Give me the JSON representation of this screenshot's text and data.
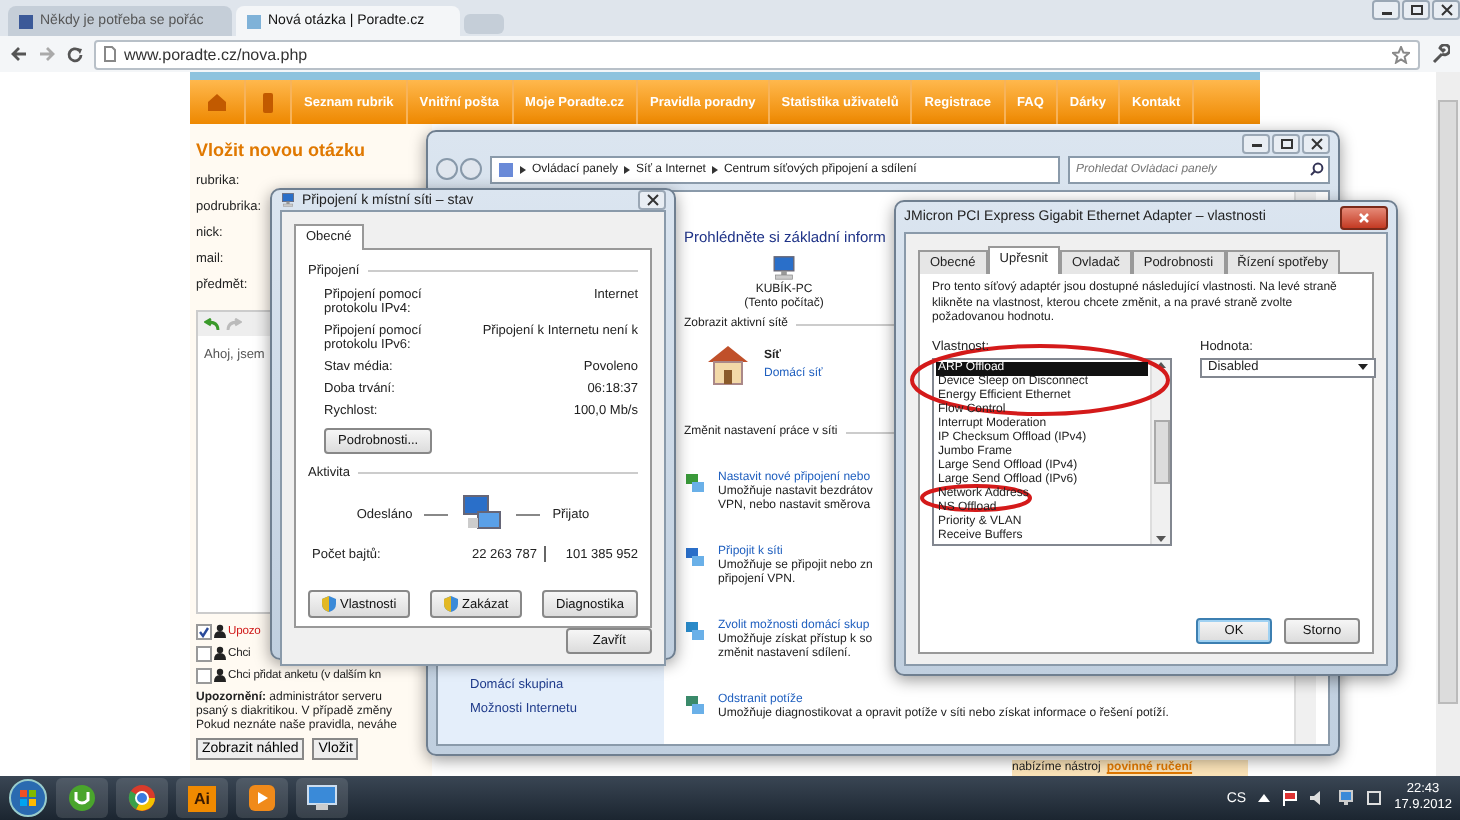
{
  "browser": {
    "tabs": [
      {
        "title": "Někdy je potřeba se pořác",
        "selected": false
      },
      {
        "title": "Nová otázka | Poradte.cz",
        "selected": true
      }
    ],
    "url": "www.poradte.cz/nova.php"
  },
  "site": {
    "nav": [
      "Seznam rubrik",
      "Vnitřní pošta",
      "Moje Poradte.cz",
      "Pravidla poradny",
      "Statistika uživatelů",
      "Registrace",
      "FAQ",
      "Dárky",
      "Kontakt"
    ],
    "form": {
      "title": "Vložit novou otázku",
      "fields": [
        "rubrika:",
        "podrubrika:",
        "nick:",
        "mail:",
        "předmět:"
      ],
      "editor_text": "Ahoj, jsem",
      "options": [
        {
          "label": "Upozo",
          "checked": true,
          "kind": "warning"
        },
        {
          "label": "Chci",
          "checked": false,
          "kind": "normal"
        },
        {
          "label": "Chci přidat anketu (v dalším kn",
          "checked": false,
          "kind": "normal"
        }
      ],
      "notice_lines": [
        "**Upozornění:** administrátor serveru",
        "psaný s diakritikou. V případě změny",
        "Pokud neznáte naše pravidla, neváhe"
      ],
      "buttons": [
        "Zobrazit náhled",
        "Vložit"
      ]
    },
    "ad": {
      "text": "nabízíme nástroj",
      "link": "povinné ručení"
    }
  },
  "control_panel": {
    "breadcrumb": [
      "Ovládací panely",
      "Síť a Internet",
      "Centrum síťových připojení a sdílení"
    ],
    "search_placeholder": "Prohledat Ovládací panely",
    "sidebar_links": [
      "Domácí skupina",
      "Možnosti Internetu"
    ],
    "heading": "Prohlédněte si základní inform",
    "computer": {
      "name": "KUBÍK-PC",
      "note": "(Tento počítač)"
    },
    "active_networks_heading": "Zobrazit aktivní sítě",
    "network": {
      "name": "Síť",
      "type": "Domácí síť"
    },
    "change_heading": "Změnit nastavení práce v síti",
    "tasks": [
      {
        "kind": "setup",
        "title": "Nastavit nové připojení nebo",
        "lines": [
          "Umožňuje nastavit bezdrátov",
          "VPN, nebo nastavit směrova"
        ]
      },
      {
        "kind": "connect",
        "title": "Připojit k síti",
        "lines": [
          "Umožňuje se připojit nebo zn",
          "připojení VPN."
        ]
      },
      {
        "kind": "homegroup",
        "title": "Zvolit možnosti domácí skup",
        "lines": [
          "Umožňuje získat přístup k so",
          "změnit nastavení sdílení."
        ]
      },
      {
        "kind": "troubleshoot",
        "title": "Odstranit potíže",
        "lines": [
          "Umožňuje diagnostikovat a opravit potíže v síti nebo získat informace o řešení potíží."
        ]
      }
    ]
  },
  "status_dialog": {
    "title": "Připojení k místní síti – stav",
    "tabs": [
      {
        "label": "Obecné",
        "selected": true
      }
    ],
    "connection_heading": "Připojení",
    "rows": [
      {
        "label": "Připojení pomocí protokolu IPv4:",
        "value": "Internet"
      },
      {
        "label": "Připojení pomocí protokolu IPv6:",
        "value": "Připojení k Internetu není k"
      },
      {
        "label": "Stav média:",
        "value": "Povoleno"
      },
      {
        "label": "Doba trvání:",
        "value": "06:18:37"
      },
      {
        "label": "Rychlost:",
        "value": "100,0 Mb/s"
      }
    ],
    "details_button": "Podrobnosti...",
    "activity_heading": "Aktivita",
    "sent_label": "Odesláno",
    "received_label": "Přijato",
    "bytes_label": "Počet bajtů:",
    "bytes_sent": "22 263 787",
    "bytes_received": "101 385 952",
    "buttons": [
      {
        "label": "Vlastnosti",
        "shield": true
      },
      {
        "label": "Zakázat",
        "shield": true
      },
      {
        "label": "Diagnostika",
        "shield": false
      }
    ],
    "close_button": "Zavřít"
  },
  "properties_dialog": {
    "title": "JMicron PCI Express Gigabit Ethernet Adapter – vlastnosti",
    "tabs": [
      {
        "label": "Obecné",
        "selected": false
      },
      {
        "label": "Upřesnit",
        "selected": true
      },
      {
        "label": "Ovladač",
        "selected": false
      },
      {
        "label": "Podrobnosti",
        "selected": false
      },
      {
        "label": "Řízení spotřeby",
        "selected": false
      }
    ],
    "description": "Pro tento síťový adaptér jsou dostupné následující vlastnosti. Na levé straně klikněte na vlastnost, kterou chcete změnit, a na pravé straně zvolte požadovanou hodnotu.",
    "property_label": "Vlastnost:",
    "properties": [
      {
        "name": "ARP Offload",
        "selected": true
      },
      {
        "name": "Device Sleep on Disconnect",
        "selected": false
      },
      {
        "name": "Energy Efficient Ethernet",
        "selected": false
      },
      {
        "name": "Flow Control",
        "selected": false
      },
      {
        "name": "Interrupt Moderation",
        "selected": false
      },
      {
        "name": "IP Checksum Offload (IPv4)",
        "selected": false
      },
      {
        "name": "Jumbo Frame",
        "selected": false
      },
      {
        "name": "Large Send Offload (IPv4)",
        "selected": false
      },
      {
        "name": "Large Send Offload (IPv6)",
        "selected": false
      },
      {
        "name": "Network Address",
        "selected": false
      },
      {
        "name": "NS Offload",
        "selected": false
      },
      {
        "name": "Priority & VLAN",
        "selected": false
      },
      {
        "name": "Receive Buffers",
        "selected": false
      }
    ],
    "value_label": "Hodnota:",
    "value": "Disabled",
    "buttons": [
      "OK",
      "Storno"
    ]
  },
  "taskbar": {
    "apps": [
      {
        "kind": "torrent"
      },
      {
        "kind": "chrome"
      },
      {
        "kind": "illustrator",
        "label": "Ai"
      },
      {
        "kind": "media"
      },
      {
        "kind": "network"
      }
    ],
    "language": "CS",
    "time": "22:43",
    "date": "17.9.2012"
  }
}
